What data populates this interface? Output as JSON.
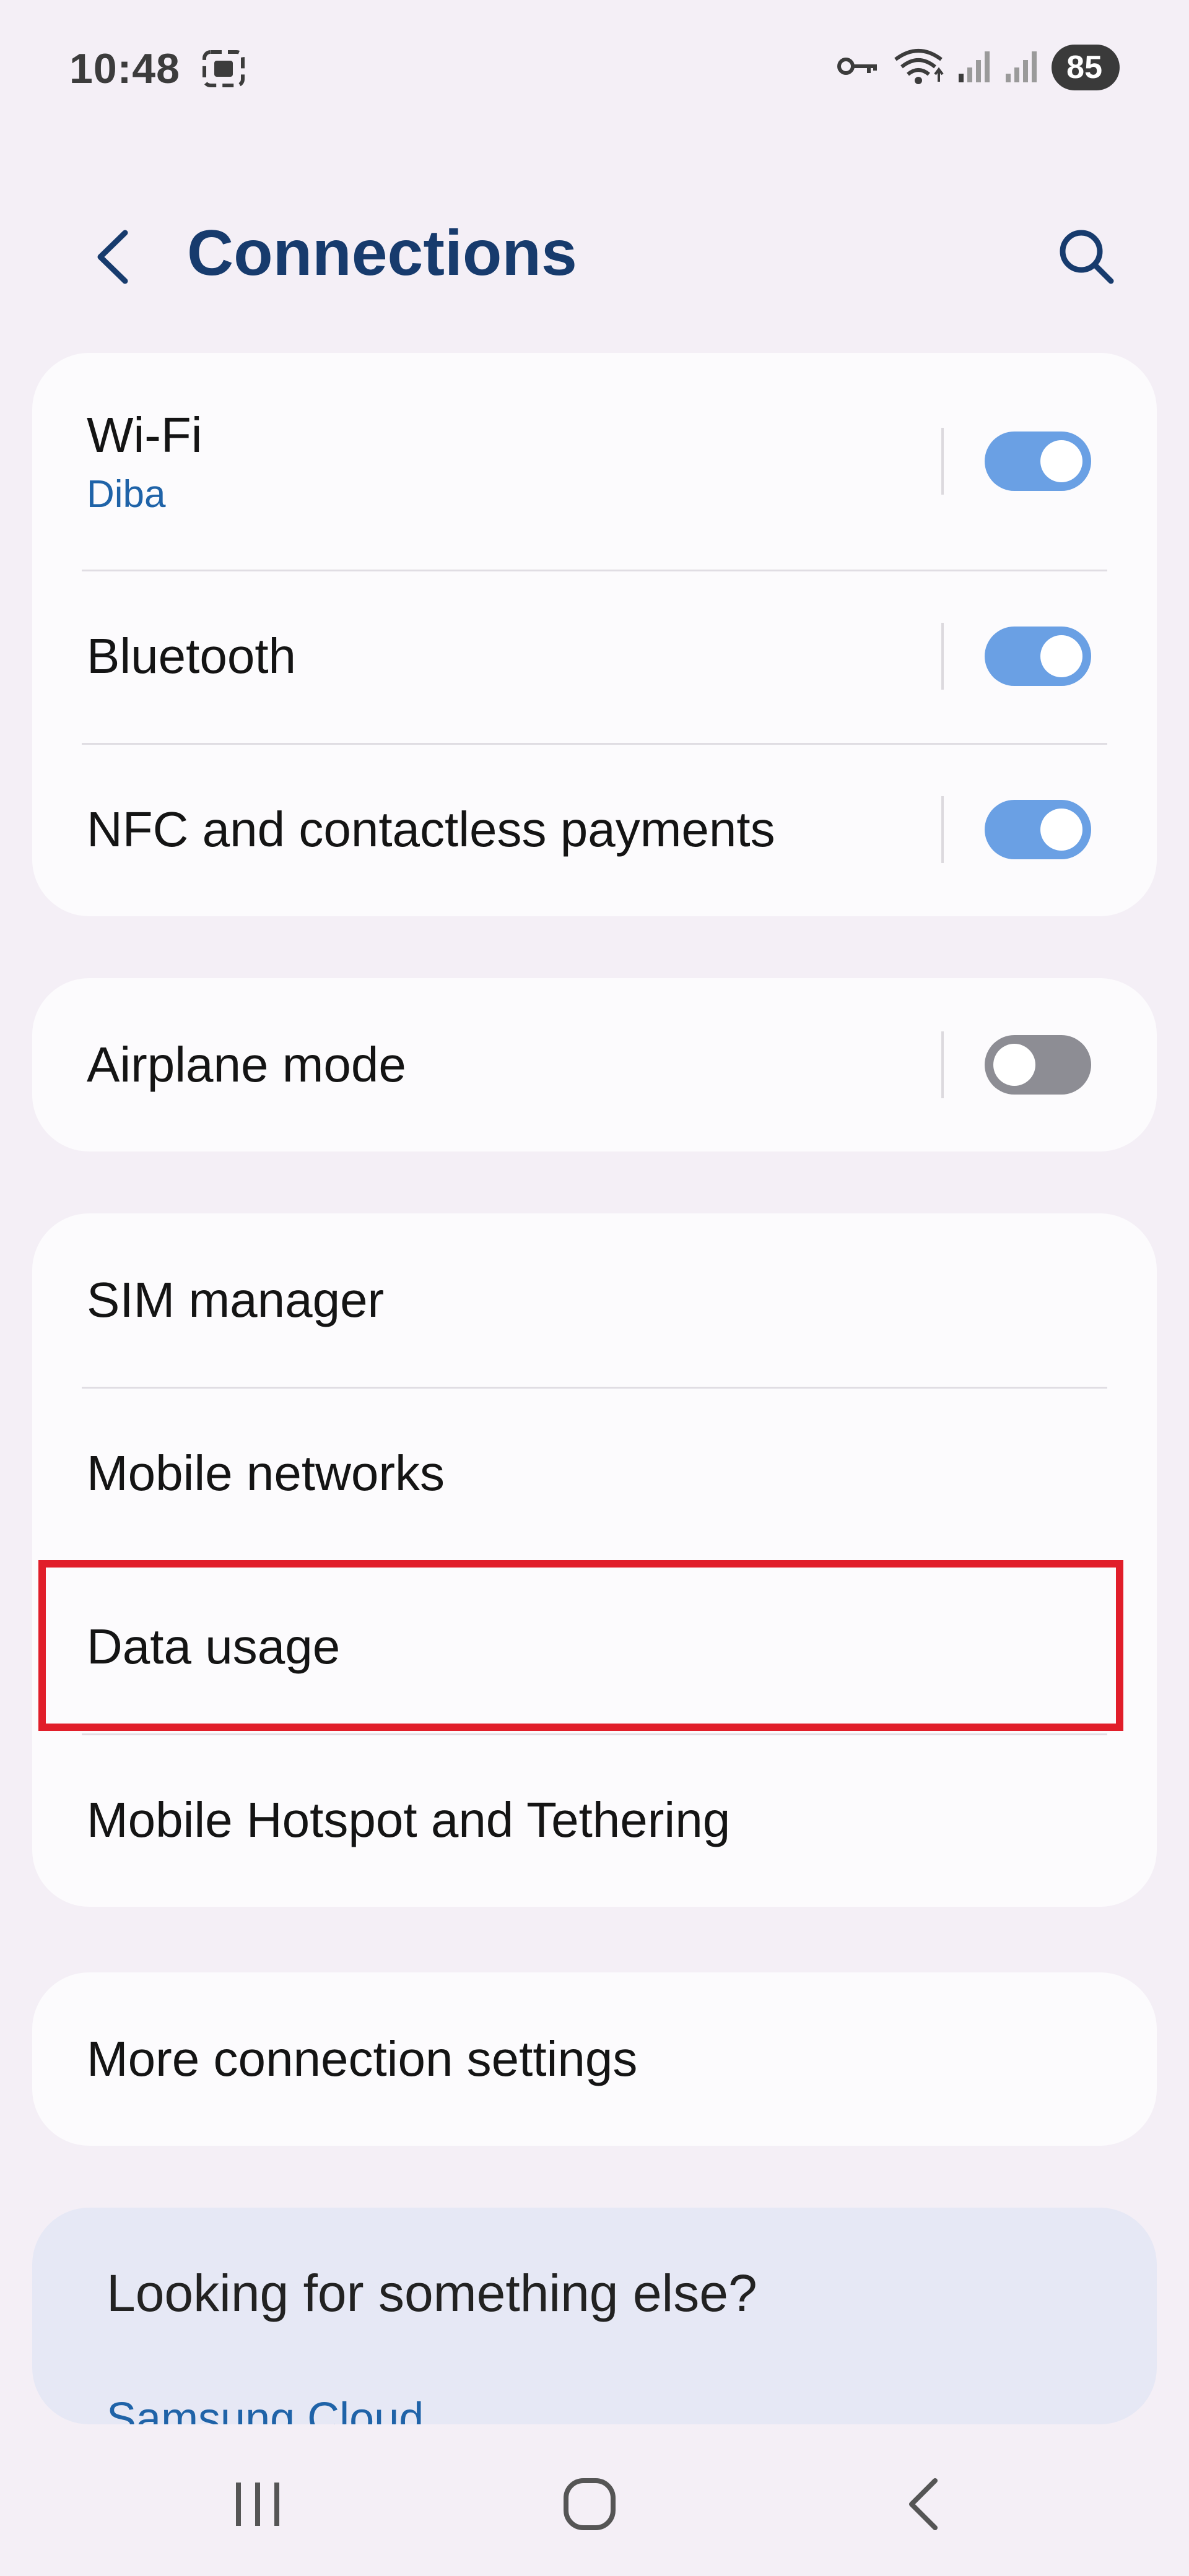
{
  "status_bar": {
    "time": "10:48",
    "battery": "85",
    "icons": [
      "screenshot-icon",
      "vpn-key-icon",
      "wifi-icon",
      "signal-1-icon",
      "signal-2-icon"
    ]
  },
  "header": {
    "title": "Connections",
    "back_icon": "chevron-left-icon",
    "search_icon": "search-icon"
  },
  "groups": [
    {
      "items": [
        {
          "label": "Wi-Fi",
          "sub": "Diba",
          "toggle": true
        },
        {
          "label": "Bluetooth",
          "toggle": true
        },
        {
          "label": "NFC and contactless payments",
          "toggle": true
        }
      ]
    },
    {
      "items": [
        {
          "label": "Airplane mode",
          "toggle": false
        }
      ]
    },
    {
      "items": [
        {
          "label": "SIM manager"
        },
        {
          "label": "Mobile networks"
        },
        {
          "label": "Data usage",
          "highlighted": true
        },
        {
          "label": "Mobile Hotspot and Tethering"
        }
      ]
    },
    {
      "items": [
        {
          "label": "More connection settings"
        }
      ]
    }
  ],
  "suggestions": {
    "title": "Looking for something else?",
    "link": "Samsung Cloud"
  },
  "nav_bar": {
    "recents_icon": "recents-icon",
    "home_icon": "home-icon",
    "back_icon": "back-icon"
  },
  "colors": {
    "background": "#f4eff6",
    "card": "#fcfbfd",
    "accent": "#6aa0e4",
    "title": "#173b6d",
    "link": "#1f63a8",
    "highlight": "#e11e2a"
  }
}
